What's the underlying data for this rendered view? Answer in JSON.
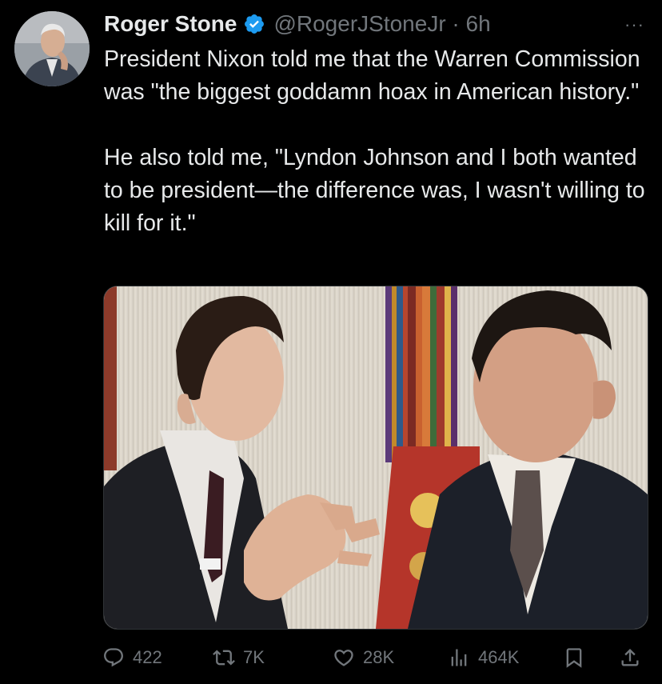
{
  "tweet": {
    "author_name": "Roger Stone",
    "handle_time": "@RogerJStoneJr · 6h",
    "paragraphs": [
      "President Nixon told me that the Warren Commission was \"the biggest goddamn hoax in American history.\"",
      "He also told me, \"Lyndon Johnson and I both wanted to be president—the difference was, I wasn't willing to kill for it.\""
    ],
    "more_label": "···"
  },
  "actions": {
    "replies": "422",
    "reposts": "7K",
    "likes": "28K",
    "views": "464K"
  },
  "icons": {
    "verified": "verified-badge-icon",
    "reply": "reply-icon",
    "repost": "repost-icon",
    "like": "heart-icon",
    "views": "views-icon",
    "bookmark": "bookmark-icon",
    "share": "share-icon"
  },
  "colors": {
    "background": "#000000",
    "text": "#e7e9ea",
    "secondary": "#71767b",
    "verified": "#1d9bf0"
  }
}
